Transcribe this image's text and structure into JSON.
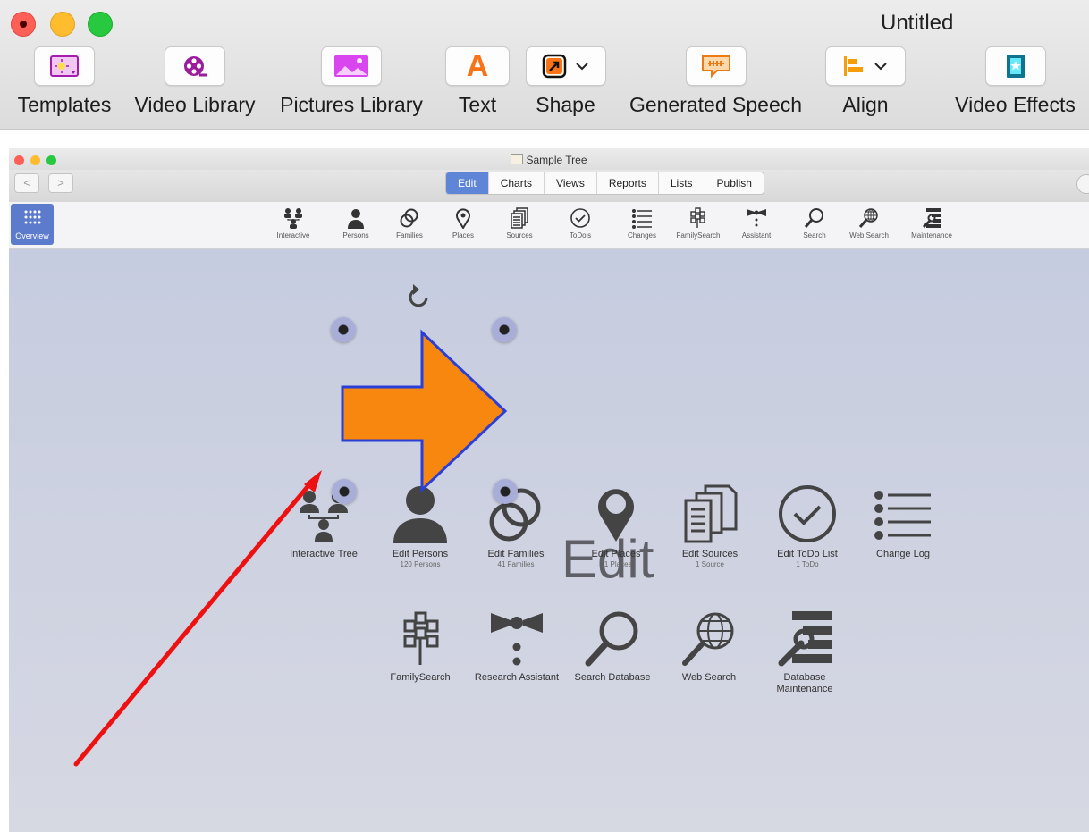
{
  "outer_window": {
    "title": "Untitled",
    "toolbar": [
      {
        "label": "Templates",
        "icon": "templates-icon"
      },
      {
        "label": "Video Library",
        "icon": "film-reel-icon"
      },
      {
        "label": "Pictures Library",
        "icon": "picture-icon"
      },
      {
        "label": "Text",
        "icon": "letter-a-icon"
      },
      {
        "label": "Shape",
        "icon": "shape-arrow-icon"
      },
      {
        "label": "Generated Speech",
        "icon": "speech-bubble-icon"
      },
      {
        "label": "Align",
        "icon": "align-left-icon"
      },
      {
        "label": "Video Effects",
        "icon": "video-effects-icon"
      }
    ]
  },
  "inner_window": {
    "title": "Sample Tree",
    "nav_back": "<",
    "nav_forward": ">",
    "tabs": [
      "Edit",
      "Charts",
      "Views",
      "Reports",
      "Lists",
      "Publish"
    ],
    "active_tab": "Edit",
    "overview_label": "Overview",
    "icon_bar": [
      "Interactive",
      "Persons",
      "Families",
      "Places",
      "Sources",
      "ToDo's",
      "Changes",
      "FamilySearch",
      "Assistant",
      "Search",
      "Web Search",
      "Maintenance"
    ]
  },
  "content": {
    "heading": "Edit",
    "row1": [
      {
        "label": "Interactive Tree",
        "sub": ""
      },
      {
        "label": "Edit Persons",
        "sub": "120 Persons"
      },
      {
        "label": "Edit Families",
        "sub": "41 Families"
      },
      {
        "label": "Edit Places",
        "sub": "51 Places"
      },
      {
        "label": "Edit Sources",
        "sub": "1 Source"
      },
      {
        "label": "Edit ToDo List",
        "sub": "1 ToDo"
      },
      {
        "label": "Change Log",
        "sub": ""
      }
    ],
    "row2": [
      {
        "label": "FamilySearch"
      },
      {
        "label": "Research Assistant"
      },
      {
        "label": "Search Database"
      },
      {
        "label": "Web Search"
      },
      {
        "label": "Database",
        "label2": "Maintenance"
      }
    ]
  },
  "annotation_colors": {
    "arrow_fill": "#f7870f",
    "arrow_stroke": "#2a3fd8",
    "red_arrow": "#ee1111"
  }
}
